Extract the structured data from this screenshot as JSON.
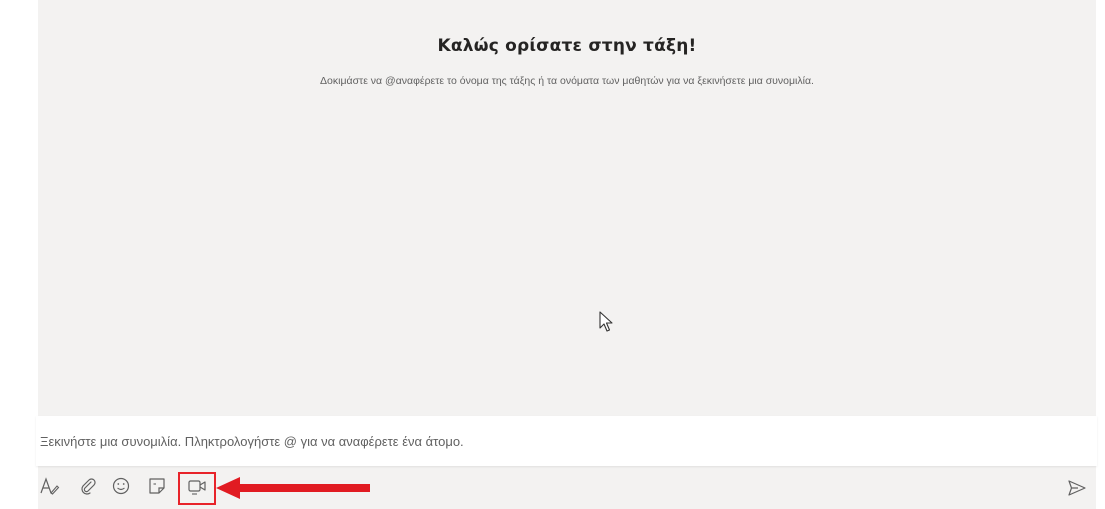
{
  "welcome": {
    "title": "Καλώς ορίσατε στην τάξη!",
    "subtitle": "Δοκιμάστε να @αναφέρετε το όνομα της τάξης ή τα ονόματα των μαθητών για να ξεκινήσετε μια συνομιλία."
  },
  "compose": {
    "placeholder": "Ξεκινήστε μια συνομιλία. Πληκτρολογήστε @ για να αναφέρετε ένα άτομο."
  },
  "toolbar": {
    "icons": [
      "format-icon",
      "attach-icon",
      "emoji-icon",
      "sticker-icon",
      "meet-now-icon",
      "send-icon"
    ]
  },
  "colors": {
    "background": "#f3f2f1",
    "highlight": "#e8232a",
    "icon": "#616161"
  }
}
